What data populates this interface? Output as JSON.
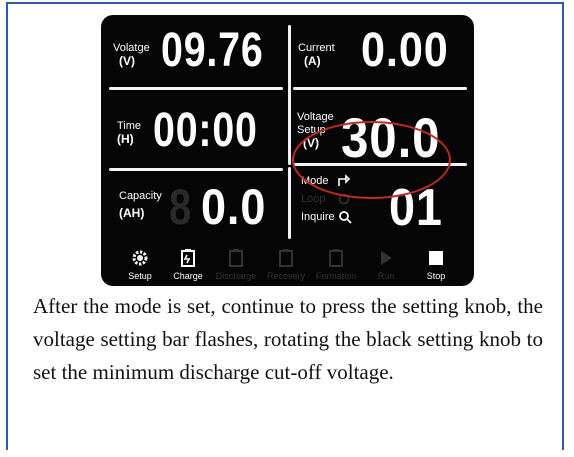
{
  "panel": {
    "voltage_label": "Volatge",
    "voltage_unit": "(V)",
    "voltage_value": "09.76",
    "current_label": "Current",
    "current_unit": "(A)",
    "current_value": "0.00",
    "time_label": "Time",
    "time_unit": "(H)",
    "time_value": "00:00",
    "voltage_setup_label_1": "Voltage",
    "voltage_setup_label_2": "Setup",
    "voltage_setup_unit": "(V)",
    "voltage_setup_value": "30.0",
    "capacity_label": "Capacity",
    "capacity_unit": "(AH)",
    "capacity_value": "0.0",
    "mode_label": "Mode",
    "loop_label": "Loop",
    "inquire_label": "Inquire",
    "mode_value": "01"
  },
  "buttons": [
    {
      "label": "Setup",
      "icon": "gear-icon",
      "active": true
    },
    {
      "label": "Charge",
      "icon": "charge-icon",
      "active": true
    },
    {
      "label": "Discharge",
      "icon": "discharge-icon",
      "active": false
    },
    {
      "label": "Recovery",
      "icon": "recovery-icon",
      "active": false
    },
    {
      "label": "Formation",
      "icon": "formation-icon",
      "active": false
    },
    {
      "label": "Run",
      "icon": "play-icon",
      "active": false
    },
    {
      "label": "Stop",
      "icon": "stop-icon",
      "active": true
    }
  ],
  "caption": "After the mode is set, continue to press the setting knob, the voltage setting bar flashes, rotating the black setting knob to set the minimum discharge cut-off    voltage.",
  "colors": {
    "highlight": "#c0282d",
    "border": "#2f5aa8",
    "lcd": "#050505"
  }
}
